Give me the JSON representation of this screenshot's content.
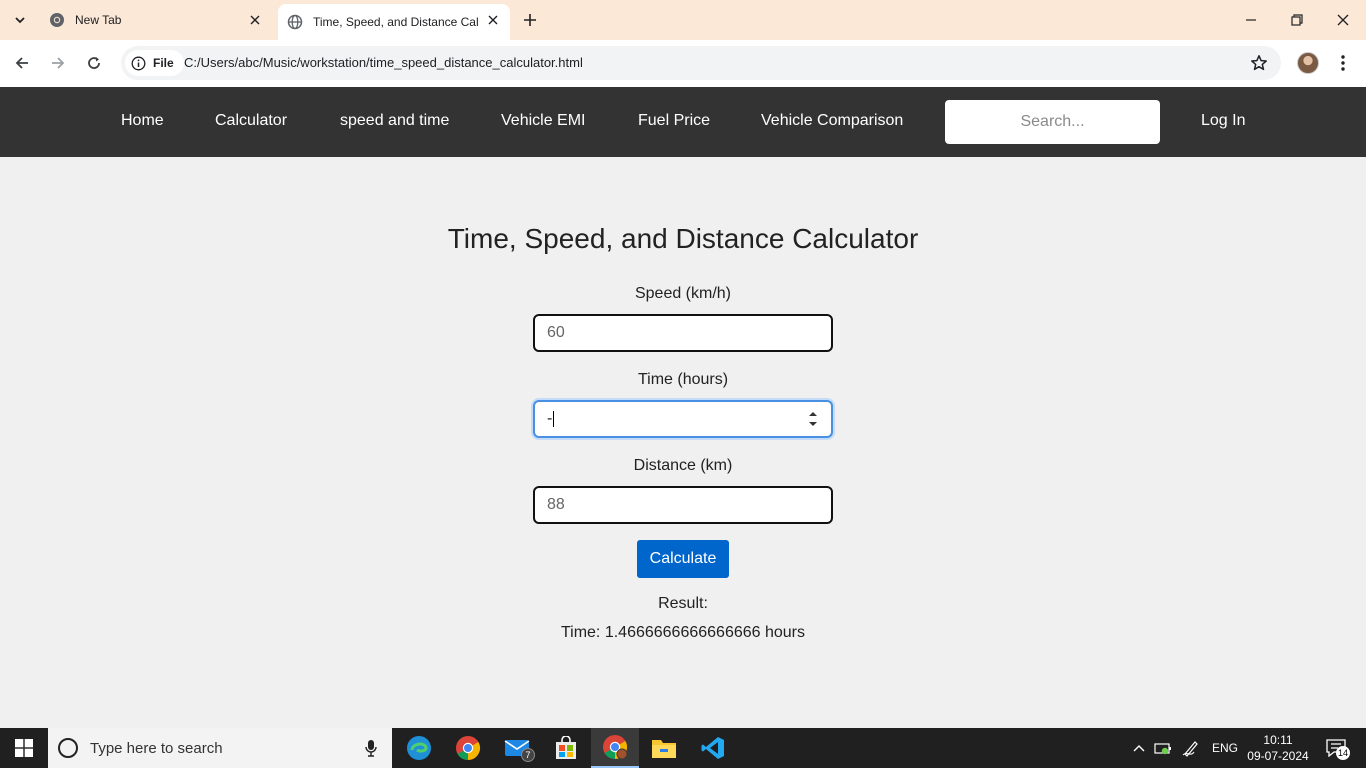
{
  "browser": {
    "tabs": [
      {
        "title": "New Tab",
        "icon": "chrome-icon"
      },
      {
        "title": "Time, Speed, and Distance Calculator",
        "icon": "globe-icon"
      }
    ],
    "address": {
      "chip_label": "File",
      "url": "C:/Users/abc/Music/workstation/time_speed_distance_calculator.html"
    }
  },
  "site_nav": {
    "links": [
      "Home",
      "Calculator",
      "speed and time",
      "Vehicle EMI",
      "Fuel Price",
      "Vehicle Comparison"
    ],
    "search_placeholder": "Search...",
    "login": "Log In"
  },
  "calculator": {
    "title": "Time, Speed, and Distance Calculator",
    "speed": {
      "label": "Speed (km/h)",
      "value": "60"
    },
    "time": {
      "label": "Time (hours)",
      "value": "-"
    },
    "distance": {
      "label": "Distance (km)",
      "value": "88"
    },
    "button": "Calculate",
    "result_label": "Result:",
    "result_value": "Time: 1.4666666666666666 hours"
  },
  "taskbar": {
    "search_placeholder": "Type here to search",
    "mail_badge": "7",
    "language": "ENG",
    "time": "10:11",
    "date": "09-07-2024",
    "notification_count": "14"
  },
  "colors": {
    "tab_strip": "#fce8d6",
    "site_nav": "#333333",
    "page_bg": "#f0f0f0",
    "calculate_button": "#0066cc",
    "focus_ring": "#4a90e2",
    "taskbar": "#202020"
  }
}
